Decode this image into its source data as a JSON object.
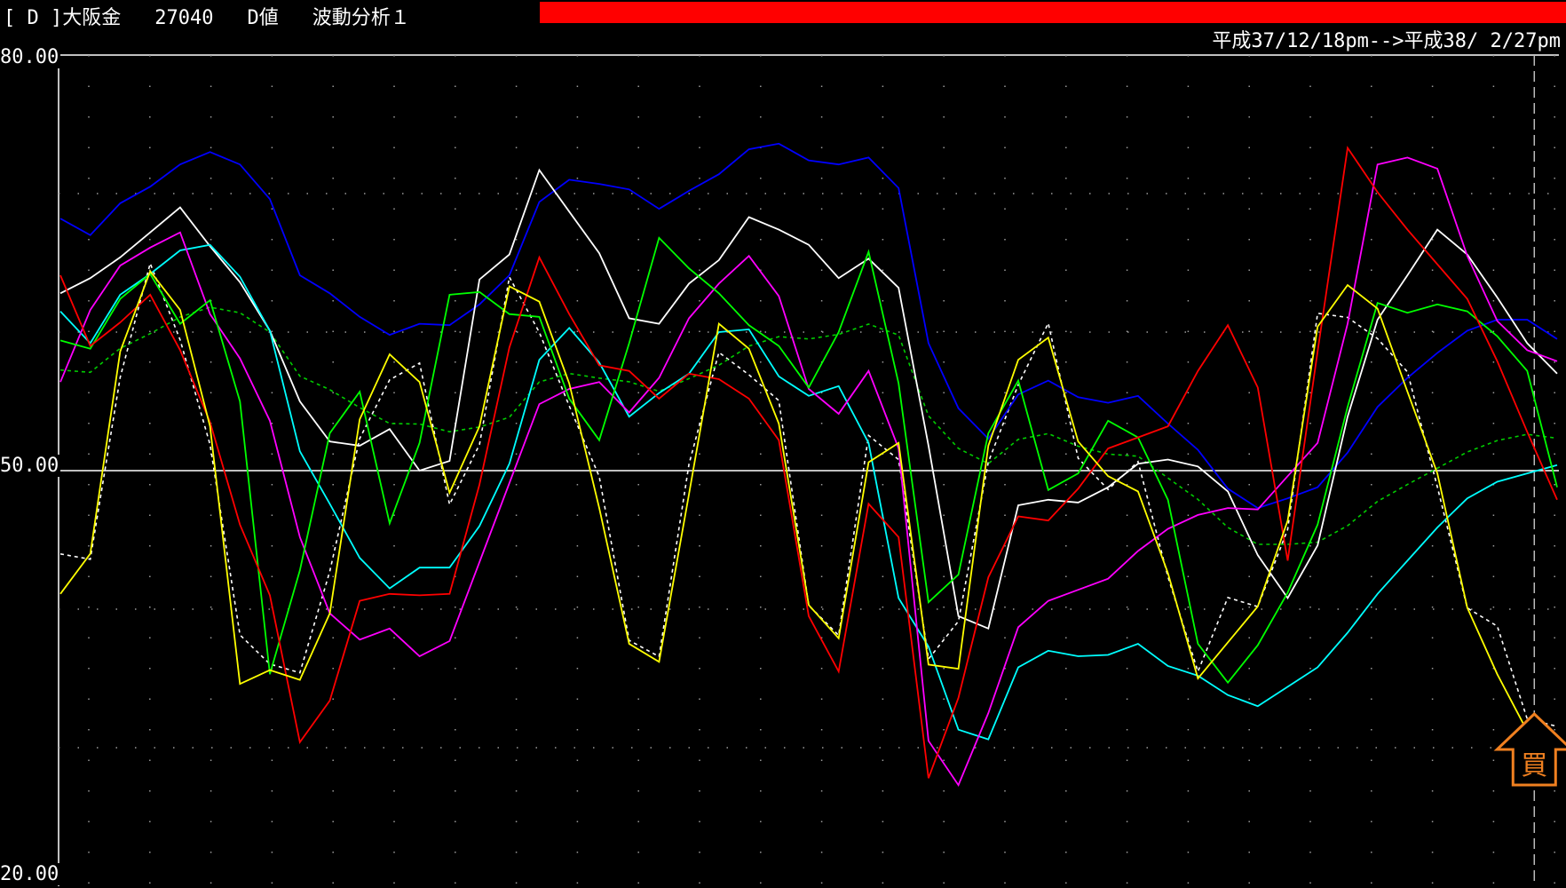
{
  "header": {
    "instrument": "[ D ]大阪金",
    "code": "27040",
    "value_type": "D値",
    "indicator": "波動分析１",
    "bar_color": "#ff0000",
    "date_range": "平成37/12/18pm-->平成38/ 2/27pm"
  },
  "buy_marker": {
    "label": "買",
    "color": "#f08020"
  },
  "chart_data": {
    "type": "line",
    "ylim": [
      20,
      80
    ],
    "yticks": [
      "80.00",
      "50.00",
      "20.00"
    ],
    "reference_line": 50,
    "grid": "dotted",
    "x": [
      1,
      2,
      3,
      4,
      5,
      6,
      7,
      8,
      9,
      10,
      11,
      12,
      13,
      14,
      15,
      16,
      17,
      18,
      19,
      20,
      21,
      22,
      23,
      24,
      25,
      26,
      27,
      28,
      29,
      30,
      31,
      32,
      33,
      34,
      35,
      36,
      37,
      38,
      39,
      40,
      41,
      42,
      43,
      44,
      45,
      46,
      47,
      48,
      49,
      50,
      51
    ],
    "series": [
      {
        "color": "#0000ff",
        "values": [
          68.2,
          67.0,
          69.3,
          70.5,
          72.1,
          73.0,
          72.1,
          69.6,
          64.1,
          62.8,
          61.1,
          59.8,
          60.6,
          60.5,
          62.0,
          64.1,
          69.4,
          71.0,
          70.7,
          70.3,
          68.9,
          70.2,
          71.4,
          73.2,
          73.6,
          72.4,
          72.1,
          72.6,
          70.4,
          59.2,
          54.5,
          52.3,
          55.5,
          56.5,
          55.3,
          54.9,
          55.4,
          53.4,
          51.5,
          48.7,
          47.3,
          48.0,
          48.8,
          51.3,
          54.6,
          56.7,
          58.5,
          60.1,
          60.9,
          60.9,
          59.5
        ]
      },
      {
        "color": "#ffffff",
        "values": [
          62.8,
          63.9,
          65.4,
          67.2,
          69.0,
          66.2,
          63.6,
          60.1,
          55.0,
          52.1,
          51.8,
          53.0,
          50.0,
          50.7,
          63.8,
          65.6,
          71.7,
          68.7,
          65.7,
          61.0,
          60.6,
          63.5,
          65.2,
          68.3,
          67.4,
          66.3,
          63.9,
          65.3,
          63.2,
          51.8,
          39.5,
          38.6,
          47.5,
          47.9,
          47.7,
          48.8,
          50.5,
          50.8,
          50.3,
          48.5,
          43.9,
          40.8,
          44.6,
          53.9,
          60.9,
          64.1,
          67.4,
          65.6,
          62.5,
          59.2,
          57.0
        ]
      },
      {
        "color": "#00ffff",
        "values": [
          61.5,
          59.2,
          62.7,
          64.2,
          65.9,
          66.3,
          64.0,
          60.1,
          51.4,
          47.6,
          43.7,
          41.5,
          43.0,
          43.0,
          46.0,
          50.5,
          58.0,
          60.3,
          57.8,
          53.9,
          55.6,
          57.0,
          60.0,
          60.2,
          56.8,
          55.4,
          56.1,
          52.0,
          40.8,
          37.3,
          31.3,
          30.6,
          35.8,
          37.0,
          36.6,
          36.7,
          37.5,
          35.9,
          35.2,
          33.8,
          33.0,
          34.4,
          35.8,
          38.3,
          41.1,
          43.5,
          45.9,
          48.0,
          49.2,
          49.8,
          50.4
        ]
      },
      {
        "color": "#ff00ff",
        "values": [
          56.4,
          61.6,
          64.8,
          66.1,
          67.2,
          61.3,
          58.1,
          53.6,
          45.2,
          39.7,
          37.8,
          38.6,
          36.6,
          37.7,
          43.4,
          49.1,
          54.8,
          55.9,
          56.4,
          54.2,
          56.7,
          61.0,
          63.5,
          65.5,
          62.6,
          55.9,
          54.1,
          57.2,
          51.6,
          30.5,
          27.3,
          32.5,
          38.7,
          40.6,
          41.4,
          42.2,
          44.2,
          45.8,
          46.8,
          47.3,
          47.2,
          49.6,
          52.0,
          60.6,
          72.1,
          72.6,
          71.8,
          65.5,
          60.8,
          58.7,
          57.9
        ]
      },
      {
        "color": "#00ff00",
        "values": [
          59.4,
          58.8,
          62.4,
          64.2,
          60.6,
          62.3,
          55.0,
          35.3,
          42.8,
          52.7,
          55.7,
          46.2,
          52.0,
          62.7,
          62.9,
          61.3,
          61.1,
          55.2,
          52.2,
          59.2,
          66.8,
          64.6,
          62.8,
          60.5,
          59.0,
          56.0,
          60.0,
          65.8,
          56.3,
          40.5,
          42.5,
          52.7,
          56.5,
          48.6,
          49.8,
          53.6,
          52.4,
          47.9,
          37.5,
          34.7,
          37.4,
          41.2,
          46.1,
          54.6,
          62.1,
          61.4,
          62.0,
          61.5,
          59.7,
          57.2,
          48.8
        ]
      },
      {
        "color": "#ff0000",
        "values": [
          64.1,
          59.0,
          60.7,
          62.7,
          58.7,
          53.5,
          46.1,
          41.0,
          30.4,
          33.4,
          40.6,
          41.1,
          41.0,
          41.1,
          49.0,
          58.9,
          65.4,
          61.3,
          57.6,
          57.2,
          55.2,
          57.0,
          56.6,
          55.2,
          52.2,
          39.5,
          35.5,
          47.6,
          45.2,
          27.8,
          33.6,
          42.3,
          46.7,
          46.4,
          48.7,
          51.6,
          52.4,
          53.2,
          57.2,
          60.5,
          56.0,
          43.5,
          58.6,
          73.3,
          70.1,
          67.4,
          64.9,
          62.4,
          57.9,
          52.8,
          47.9
        ]
      },
      {
        "color": "#ffff00",
        "values": [
          41.1,
          44.0,
          58.6,
          64.4,
          61.6,
          53.2,
          34.6,
          35.6,
          34.9,
          39.7,
          53.7,
          58.4,
          56.4,
          48.4,
          53.2,
          63.3,
          62.2,
          56.3,
          47.3,
          37.5,
          36.2,
          48.3,
          60.6,
          58.8,
          53.4,
          40.3,
          37.9,
          50.6,
          52.0,
          36.0,
          35.7,
          51.8,
          58.0,
          59.6,
          52.1,
          49.6,
          48.5,
          42.6,
          35.0,
          37.6,
          40.2,
          46.4,
          60.4,
          63.4,
          61.7,
          55.7,
          49.8,
          40.1,
          35.3,
          31.2,
          30.6
        ]
      }
    ]
  }
}
